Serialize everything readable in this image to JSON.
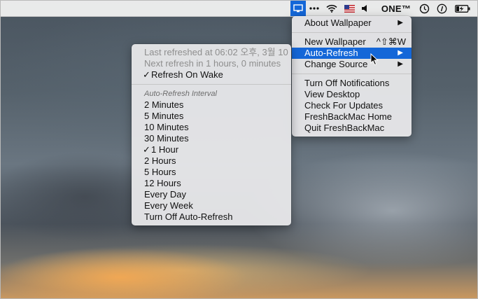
{
  "menubar": {
    "app_icon": "display-icon",
    "more_icon": "ellipsis-icon",
    "wifi_icon": "wifi-icon",
    "flag_icon": "us-flag-icon",
    "volume_icon": "speaker-icon",
    "user_label": "ONE™",
    "time_machine_icon": "time-machine-icon",
    "info_icon": "info-icon",
    "battery_icon": "battery-charging-icon"
  },
  "main_menu": {
    "items": [
      {
        "label": "About Wallpaper",
        "arrow": "▶"
      },
      {
        "label": "New Wallpaper",
        "shortcut": "^⇧⌘W"
      },
      {
        "label": "Auto-Refresh",
        "arrow": "▶"
      },
      {
        "label": "Change Source",
        "arrow": "▶"
      },
      {
        "label": "Turn Off Notifications"
      },
      {
        "label": "View Desktop"
      },
      {
        "label": "Check For Updates"
      },
      {
        "label": "FreshBackMac Home"
      },
      {
        "label": "Quit FreshBackMac"
      }
    ]
  },
  "submenu": {
    "last_refreshed": "Last refreshed at 06:02 오후, 3월 10",
    "next_refresh": "Next refresh in 1 hours, 0 minutes",
    "refresh_on_wake": "Refresh On Wake",
    "interval_header": "Auto-Refresh Interval",
    "check_mark": "✓",
    "intervals": [
      "2 Minutes",
      "5 Minutes",
      "10 Minutes",
      "30 Minutes",
      "1 Hour",
      "2 Hours",
      "5 Hours",
      "12 Hours",
      "Every Day",
      "Every Week"
    ],
    "turn_off": "Turn Off Auto-Refresh"
  },
  "colors": {
    "highlight": "#1467d8",
    "menu_bg": "#e8e8ea"
  }
}
